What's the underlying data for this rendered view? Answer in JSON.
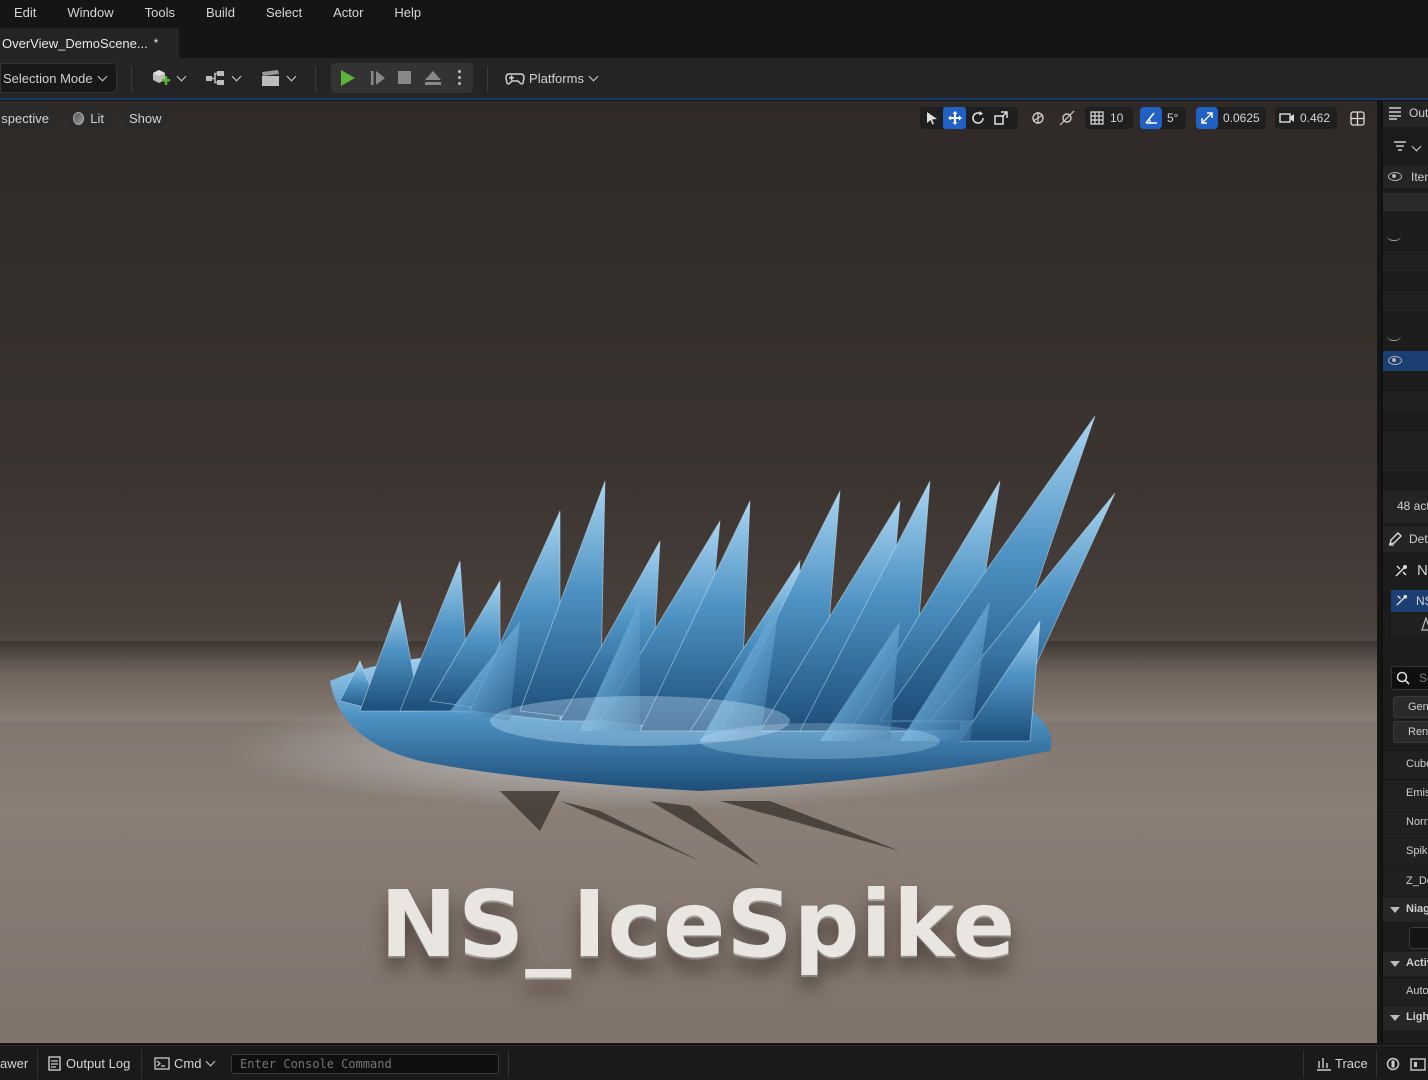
{
  "menu": [
    "Edit",
    "Window",
    "Tools",
    "Build",
    "Select",
    "Actor",
    "Help"
  ],
  "tab": {
    "title": "OverView_DemoScene...",
    "modified_marker": "*"
  },
  "toolbar": {
    "selection_mode": "Selection Mode",
    "platforms": "Platforms"
  },
  "viewport": {
    "view_mode": "spective",
    "lit_label": "Lit",
    "show_label": "Show",
    "grid_snap": "10",
    "rotation_snap": "5°",
    "scale_snap": "0.0625",
    "camera_speed": "0.462",
    "scene_text": "NS_IceSpike"
  },
  "outliner": {
    "title": "Out",
    "column": "Iten",
    "actor_count": "48 act"
  },
  "details": {
    "title": "Det",
    "object_name": "N",
    "component_name": "NS",
    "search_placeholder": "Se",
    "tabs": [
      "Gene",
      "Rend"
    ],
    "properties": [
      "Cube",
      "Emis",
      "Norn",
      "Spik",
      "Z_De"
    ],
    "sections": [
      "Niag",
      "Activ",
      "Auto",
      "Light"
    ]
  },
  "statusbar": {
    "drawer": "awer",
    "output_log": "Output Log",
    "cmd": "Cmd",
    "console_placeholder": "Enter Console Command",
    "trace": "Trace"
  },
  "colors": {
    "accent": "#2160c4",
    "play": "#5eb33b",
    "background": "#151515"
  }
}
